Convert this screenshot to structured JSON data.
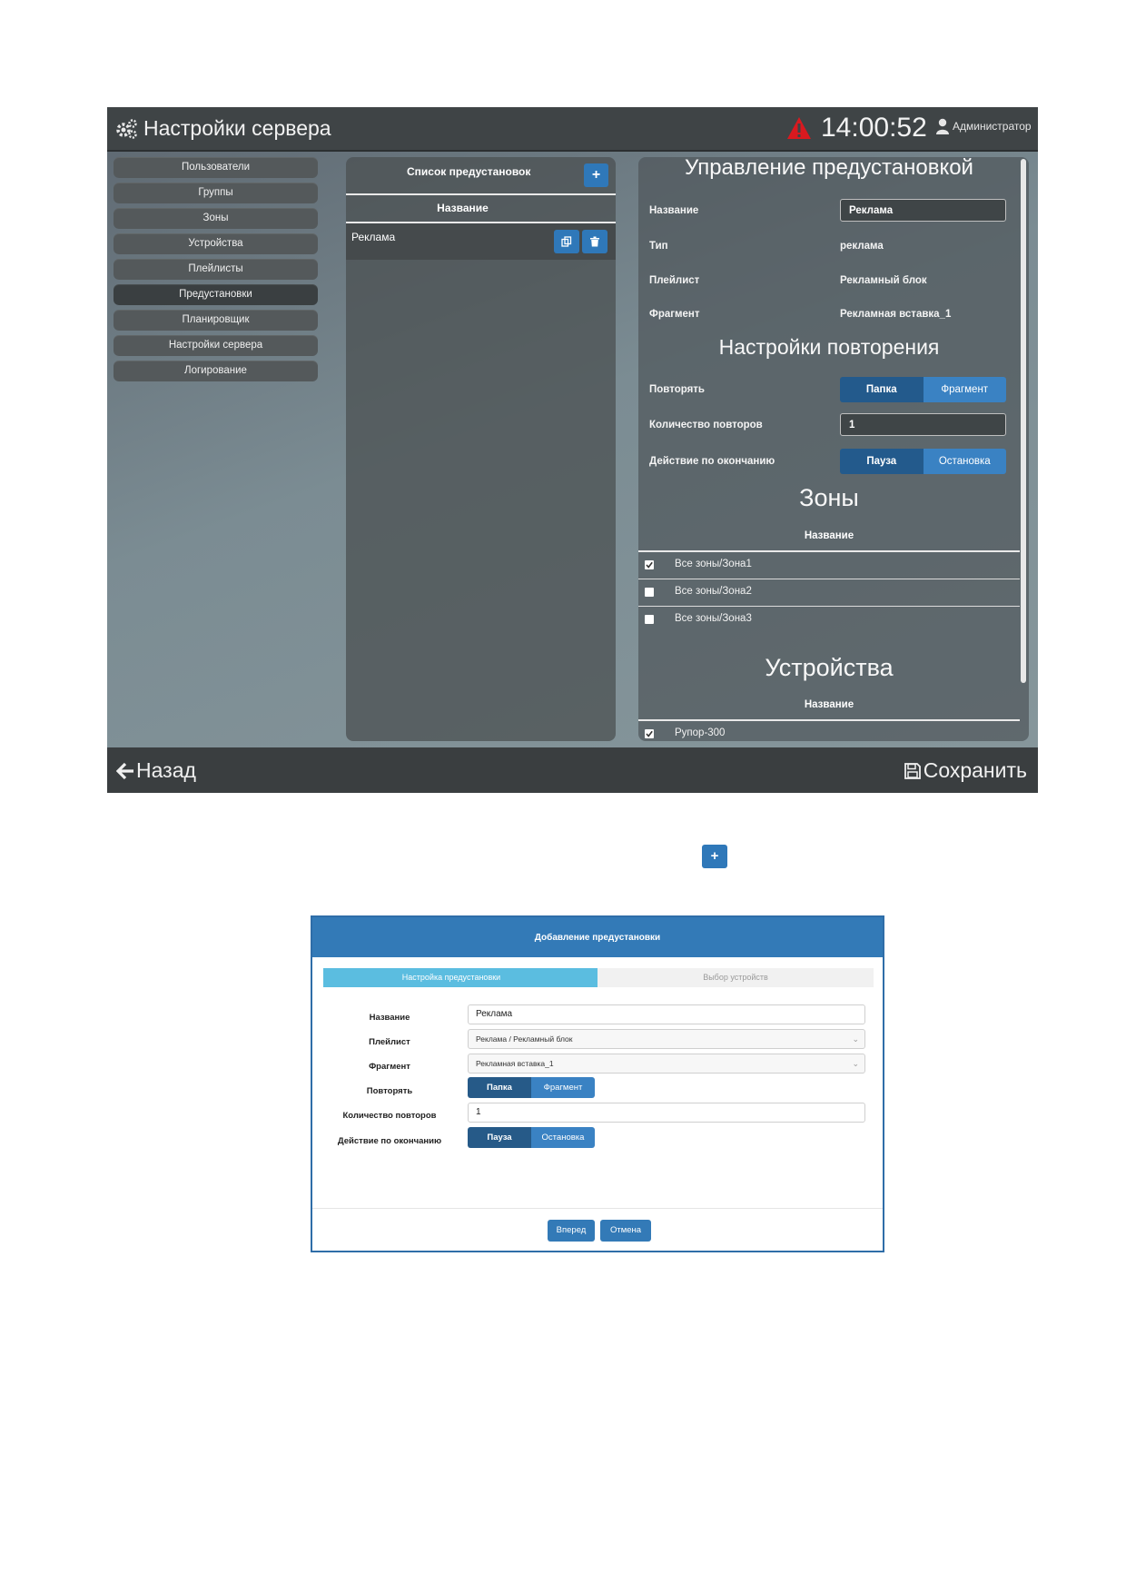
{
  "app": {
    "title": "Настройки сервера",
    "title_icon": "gears-icon",
    "clock": "14:00:52",
    "user": "Администратор",
    "back_label": "Назад",
    "save_label": "Сохранить",
    "colors": {
      "accent": "#337ab7",
      "warning": "#d9191f",
      "topbar": "#3f4446"
    }
  },
  "sidebar": {
    "items": [
      {
        "label": "Пользователи",
        "active": false
      },
      {
        "label": "Группы",
        "active": false
      },
      {
        "label": "Зоны",
        "active": false
      },
      {
        "label": "Устройства",
        "active": false
      },
      {
        "label": "Плейлисты",
        "active": false
      },
      {
        "label": "Предустановки",
        "active": true
      },
      {
        "label": "Планировщик",
        "active": false
      },
      {
        "label": "Настройки сервера",
        "active": false
      },
      {
        "label": "Логирование",
        "active": false
      }
    ]
  },
  "preset_list": {
    "title": "Список предустановок",
    "add_label": "+",
    "column": "Название",
    "rows": [
      {
        "name": "Реклама"
      }
    ]
  },
  "detail": {
    "title": "Управление предустановкой",
    "name_label": "Название",
    "name_value": "Реклама",
    "type_label": "Тип",
    "type_value": "реклама",
    "playlist_label": "Плейлист",
    "playlist_value": "Рекламный блок",
    "fragment_label": "Фрагмент",
    "fragment_value": "Рекламная вставка_1",
    "repeat_section": "Настройки повторения",
    "repeat_label": "Повторять",
    "repeat_options": [
      "Папка",
      "Фрагмент"
    ],
    "count_label": "Количество повторов",
    "count_value": "1",
    "end_label": "Действие по окончанию",
    "end_options": [
      "Пауза",
      "Остановка"
    ],
    "zones_title": "Зоны",
    "zones_column": "Название",
    "zones": [
      {
        "label": "Все зоны/Зона1",
        "checked": true
      },
      {
        "label": "Все зоны/Зона2",
        "checked": false
      },
      {
        "label": "Все зоны/Зона3",
        "checked": false
      }
    ],
    "devices_title": "Устройства",
    "devices_column": "Название",
    "devices": [
      {
        "label": "Рупор-300",
        "checked": true
      }
    ]
  },
  "standalone_add": {
    "label": "+"
  },
  "modal": {
    "title": "Добавление предустановки",
    "steps": [
      "Настройка предустановки",
      "Выбор устройств"
    ],
    "name_label": "Название",
    "name_value": "Реклама",
    "playlist_label": "Плейлист",
    "playlist_value": "Реклама / Рекламный блок",
    "fragment_label": "Фрагмент",
    "fragment_value": "Рекламная вставка_1",
    "repeat_label": "Повторять",
    "repeat_options": [
      "Папка",
      "Фрагмент"
    ],
    "count_label": "Количество повторов",
    "count_value": "1",
    "end_label": "Действие по окончанию",
    "end_options": [
      "Пауза",
      "Остановка"
    ],
    "next_label": "Вперед",
    "cancel_label": "Отмена"
  }
}
